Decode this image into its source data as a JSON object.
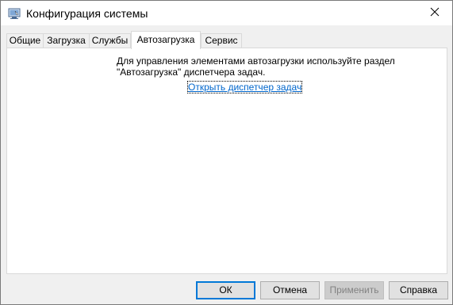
{
  "window": {
    "title": "Конфигурация системы",
    "icon": "msconfig-icon",
    "close_icon": "close-icon"
  },
  "tabs": [
    {
      "label": "Общие",
      "active": false
    },
    {
      "label": "Загрузка",
      "active": false
    },
    {
      "label": "Службы",
      "active": false
    },
    {
      "label": "Автозагрузка",
      "active": true
    },
    {
      "label": "Сервис",
      "active": false
    }
  ],
  "startup": {
    "message_line1": "Для управления элементами автозагрузки используйте раздел",
    "message_line2": "\"Автозагрузка\" диспетчера задач.",
    "link_text": "Открыть диспетчер задач"
  },
  "buttons": {
    "ok": "ОК",
    "cancel": "Отмена",
    "apply": "Применить",
    "help": "Справка"
  },
  "colors": {
    "link": "#0066cc",
    "accent": "#0078d7"
  }
}
